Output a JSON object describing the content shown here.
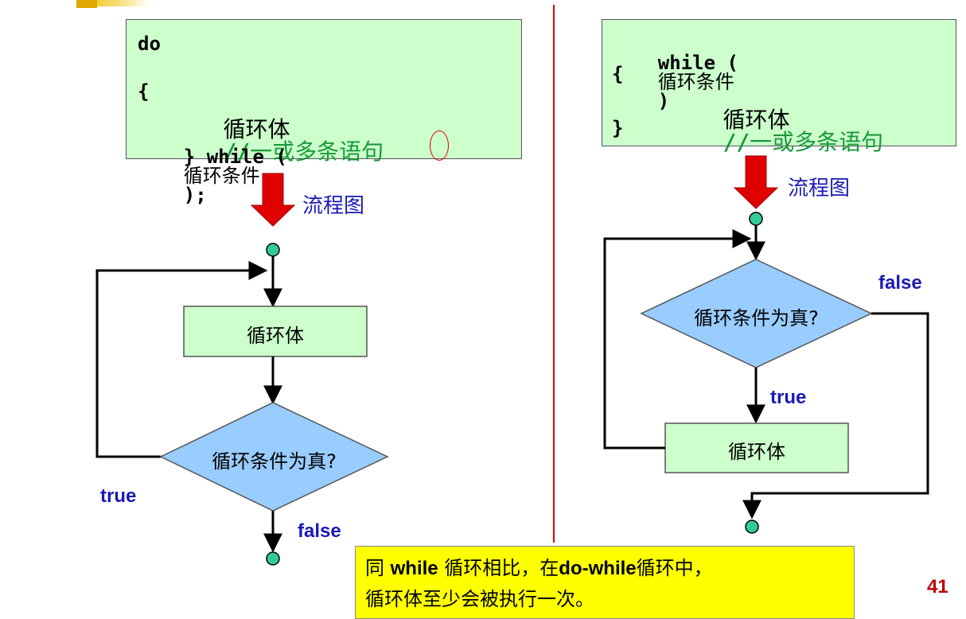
{
  "left": {
    "code": {
      "line1": "do",
      "line2": "{",
      "line3_body": "循环体",
      "line3_comment_slashes": "//",
      "line3_comment_text": "一或多条语句",
      "line4_prefix": "} while (",
      "line4_cond": "循环条件",
      "line4_close": ")",
      "line4_semicolon": ";"
    },
    "arrow_label": "流程图",
    "body_node": "循环体",
    "cond_node": "循环条件为真?",
    "true_label": "true",
    "false_label": "false"
  },
  "right": {
    "code": {
      "line1_kw": "while (",
      "line1_cond": "循环条件",
      "line1_close": ")",
      "line2": "{",
      "line3_body": "循环体",
      "line3_comment_slashes": "//",
      "line3_comment_text": "一或多条语句",
      "line4": "}"
    },
    "arrow_label": "流程图",
    "cond_node": "循环条件为真?",
    "body_node": "循环体",
    "true_label": "true",
    "false_label": "false"
  },
  "note": {
    "part1": "同 ",
    "kw_while": "while",
    "part2": " 循环相比，在",
    "kw_dowhile": "do-while",
    "part3": "循环中，",
    "line2": "循环体至少会被执行一次。"
  },
  "page_number": "41",
  "colors": {
    "code_bg": "#ccffcc",
    "comment": "#1a9a3a",
    "label_blue": "#1a1ab4",
    "node_rect": "#ccffcc",
    "node_diamond": "#99ccff",
    "terminal": "#33cc99",
    "down_arrow": "#e00000",
    "divider": "#e00000",
    "note_bg": "#ffff00",
    "page_number": "#c00000"
  }
}
